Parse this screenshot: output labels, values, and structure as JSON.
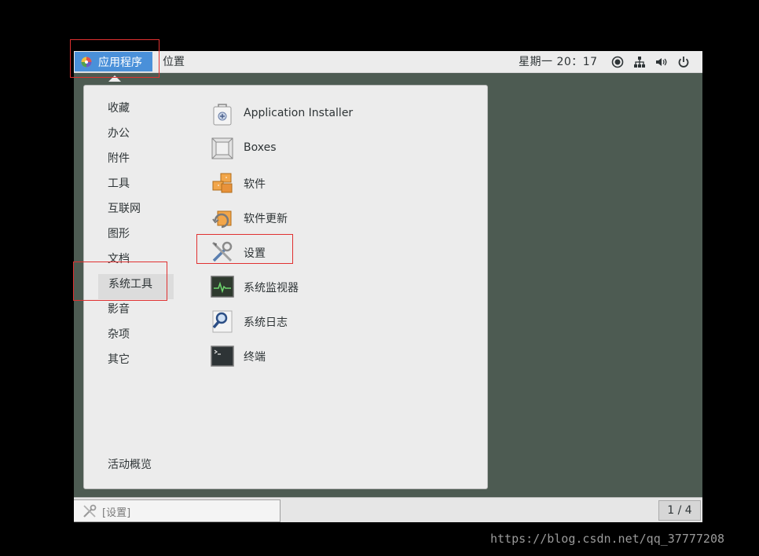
{
  "topbar": {
    "apps_label": "应用程序",
    "places_label": "位置",
    "clock": "星期一 20：17",
    "tray_icons": [
      "accessibility-icon",
      "network-icon",
      "volume-icon",
      "power-icon"
    ]
  },
  "menu": {
    "categories": [
      {
        "label": "收藏"
      },
      {
        "label": "办公"
      },
      {
        "label": "附件"
      },
      {
        "label": "工具"
      },
      {
        "label": "互联网"
      },
      {
        "label": "图形"
      },
      {
        "label": "文档"
      },
      {
        "label": "系统工具",
        "selected": true
      },
      {
        "label": "影音"
      },
      {
        "label": "杂项"
      },
      {
        "label": "其它"
      }
    ],
    "apps": [
      {
        "label": "Application Installer",
        "icon": "installer-icon"
      },
      {
        "label": "Boxes",
        "icon": "boxes-icon"
      },
      {
        "label": "软件",
        "icon": "software-icon"
      },
      {
        "label": "软件更新",
        "icon": "software-update-icon"
      },
      {
        "label": "设置",
        "icon": "settings-icon"
      },
      {
        "label": "系统监视器",
        "icon": "system-monitor-icon"
      },
      {
        "label": "系统日志",
        "icon": "system-log-icon"
      },
      {
        "label": "终端",
        "icon": "terminal-icon"
      }
    ],
    "activities_label": "活动概览"
  },
  "bottombar": {
    "task_label": "[设置]",
    "pager": "1 / 4"
  },
  "watermark": "https://blog.csdn.net/qq_37777208",
  "colors": {
    "accent": "#4a90d9",
    "desktop": "#4d5b52",
    "highlight_box": "#e03030"
  }
}
